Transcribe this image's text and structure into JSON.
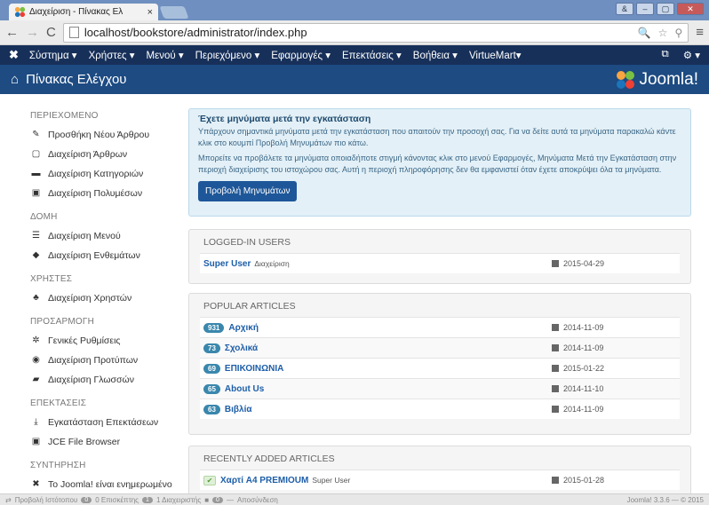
{
  "browser": {
    "tab_title": "Διαχείριση - Πίνακας Ελ",
    "tab_close": "×",
    "url": "localhost/bookstore/administrator/index.php",
    "window_buttons": [
      "&",
      "–",
      "▢",
      "✕"
    ]
  },
  "adminbar": {
    "logo": "✖",
    "menu": [
      "Σύστημα ▾",
      "Χρήστες ▾",
      "Μενού ▾",
      "Περιεχόμενο ▾",
      "Εφαρμογές ▾",
      "Επεκτάσεις ▾",
      "Βοήθεια ▾",
      "VirtueMart▾"
    ],
    "right": [
      "⧉",
      "⚙ ▾"
    ]
  },
  "header": {
    "title": "Πίνακας Ελέγχου",
    "brand": "Joomla!",
    "brand_color": "#f9a541"
  },
  "sidebar": {
    "sections": [
      {
        "heading": "ΠΕΡΙΕΧΟΜΕΝΟ",
        "items": [
          {
            "icon": "✎",
            "icon_name": "pencil-icon",
            "label": "Προσθήκη Νέου Άρθρου"
          },
          {
            "icon": "▢",
            "icon_name": "stack-icon",
            "label": "Διαχείριση Άρθρων"
          },
          {
            "icon": "▬",
            "icon_name": "folder-icon",
            "label": "Διαχείριση Κατηγοριών"
          },
          {
            "icon": "▣",
            "icon_name": "image-icon",
            "label": "Διαχείριση Πολυμέσων"
          }
        ]
      },
      {
        "heading": "ΔΟΜΗ",
        "items": [
          {
            "icon": "☰",
            "icon_name": "list-icon",
            "label": "Διαχείριση Μενού"
          },
          {
            "icon": "◆",
            "icon_name": "cube-icon",
            "label": "Διαχείριση Ενθεμάτων"
          }
        ]
      },
      {
        "heading": "ΧΡΗΣΤΕΣ",
        "items": [
          {
            "icon": "♣",
            "icon_name": "users-icon",
            "label": "Διαχείριση Χρηστών"
          }
        ]
      },
      {
        "heading": "ΠΡΟΣΑΡΜΟΓΗ",
        "items": [
          {
            "icon": "✲",
            "icon_name": "cog-icon",
            "label": "Γενικές Ρυθμίσεις"
          },
          {
            "icon": "◉",
            "icon_name": "eye-icon",
            "label": "Διαχείριση Προτύπων"
          },
          {
            "icon": "▰",
            "icon_name": "comments-icon",
            "label": "Διαχείριση Γλωσσών"
          }
        ]
      },
      {
        "heading": "ΕΠΕΚΤΑΣΕΙΣ",
        "items": [
          {
            "icon": "⤓",
            "icon_name": "upload-icon",
            "label": "Εγκατάσταση Επεκτάσεων"
          },
          {
            "icon": "▣",
            "icon_name": "image-icon",
            "label": "JCE File Browser"
          }
        ]
      },
      {
        "heading": "ΣΥΝΤΗΡΗΣΗ",
        "items": [
          {
            "icon": "✖",
            "icon_name": "joomla-icon",
            "label": "Το Joomla! είναι ενημερωμένο"
          }
        ]
      }
    ]
  },
  "alert": {
    "title": "Έχετε μηνύματα μετά την εγκατάσταση",
    "p1": "Υπάρχουν σημαντικά μηνύματα μετά την εγκατάσταση που απαιτούν την προσοχή σας. Για να δείτε αυτά τα μηνύματα παρακαλώ κάντε κλικ στο κουμπί Προβολή Μηνυμάτων πιο κάτω.",
    "p2": "Μπορείτε να προβάλετε τα μηνύματα οποιαδήποτε στιγμή κάνοντας κλικ στο μενού Εφαρμογές, Μηνύματα Μετά την Εγκατάσταση στην περιοχή διαχείρισης του ιστοχώρου σας. Αυτή η περιοχή πληροφόρησης δεν θα εμφανιστεί όταν έχετε αποκρύψει όλα τα μηνύματα.",
    "button": "Προβολή Μηνυμάτων"
  },
  "logged_in": {
    "heading": "LOGGED-IN USERS",
    "rows": [
      {
        "name": "Super User",
        "sub": "Διαχείριση",
        "date": "2015-04-29"
      }
    ]
  },
  "popular": {
    "heading": "POPULAR ARTICLES",
    "rows": [
      {
        "hits": "931",
        "title": "Αρχική",
        "date": "2014-11-09"
      },
      {
        "hits": "73",
        "title": "Σχολικά",
        "date": "2014-11-09"
      },
      {
        "hits": "69",
        "title": "ΕΠΙΚΟΙΝΩΝΙΑ",
        "date": "2015-01-22"
      },
      {
        "hits": "65",
        "title": "About Us",
        "date": "2014-11-10"
      },
      {
        "hits": "63",
        "title": "Βιβλία",
        "date": "2014-11-09"
      }
    ]
  },
  "recent": {
    "heading": "RECENTLY ADDED ARTICLES",
    "rows": [
      {
        "title": "Χαρτί A4 PREMIOUM",
        "author": "Super User",
        "date": "2015-01-28"
      }
    ]
  },
  "statusbar": {
    "view_site": "Προβολή Ιστότοπου",
    "visitors_count": "0",
    "visitors_label": "0 Επισκέπτης",
    "admins_count": "1",
    "admins_label": "1 Διαχειριστής",
    "messages_count": "0",
    "logout": "Αποσύνδεση",
    "version": "Joomla! 3.3.6 — © 2015"
  }
}
